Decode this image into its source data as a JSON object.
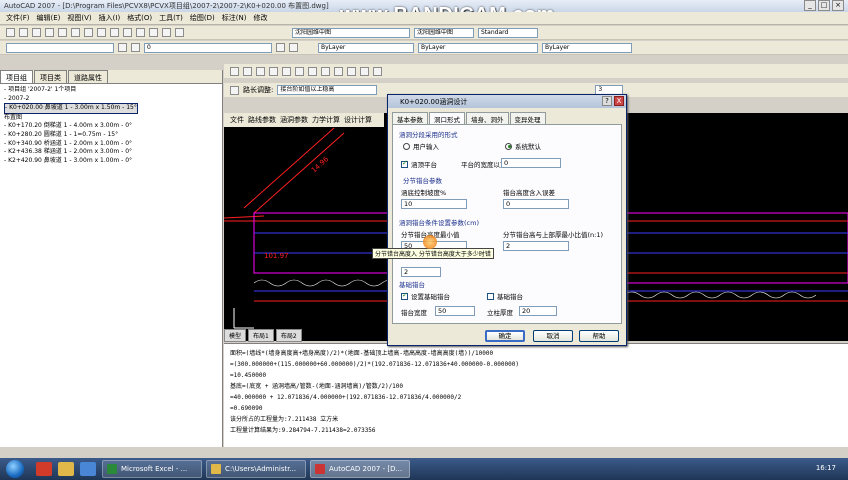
{
  "window": {
    "title": "AutoCAD 2007 - [D:\\Program Files\\PCVX8\\PCVX项目组\\2007-2\\2007-2\\K0+020.00 布置图.dwg]",
    "watermark": "www.BANDICAM.com"
  },
  "menu": [
    "文件(F)",
    "编辑(E)",
    "视图(V)",
    "插入(I)",
    "格式(O)",
    "工具(T)",
    "绘图(D)",
    "标注(N)",
    "修改"
  ],
  "toolbars": {
    "layer_combo": "0",
    "style_combo": "沈阳园维中图",
    "style2_combo": "沈阳园维中图",
    "standard_combo": "Standard",
    "color_combo": "ByLayer",
    "linetype_combo": "ByLayer",
    "lineweight_combo": "ByLayer",
    "road_label": "路长调整:",
    "road_combo": "接台阶如值以上稳高",
    "scale_value": "3"
  },
  "left_panel": {
    "tabs": [
      "项目组",
      "项目类",
      "道路属性"
    ],
    "tree": [
      "- 项目组 '2007-2' 1个项目",
      "  - 2007-2",
      "    - K0+020.00 鼻坡道 1 - 3.00m x 1.50m - 15°",
      "        布置图",
      "    - K0+170.20 倒梯道 1 - 4.00m x 3.00m - 0°",
      "    - K0+280.20 圆梯道 1 - 1=0.75m - 15°",
      "    - K0+340.90 桥涵道 1 - 2.00m x 1.00m - 0°",
      "    - K2+436.38 梯涵道 1 - 2.00m x 3.00m - 0°",
      "    - K2+420.90 鼻坡道 1 - 3.00m x 1.00m - 0°"
    ]
  },
  "right_toolbar": {
    "tabs": [
      "文件",
      "路线参数",
      "涵洞参数",
      "力学计算",
      "设计计算"
    ]
  },
  "cad_tabs": [
    "模型",
    "布局1",
    "布局2"
  ],
  "dialog": {
    "title": "K0+020.00涵洞设计",
    "help_btn": "?",
    "close_btn": "X",
    "tabs": [
      "基本参数",
      "洞口形式",
      "墙身、洞外",
      "变异处理"
    ],
    "opt_group": "涵洞分段采用的形式",
    "radio_user": "用户输入",
    "radio_system": "系统默认",
    "platform_check": "涵顶平台",
    "platform_label": "平台的宽度以顶",
    "platform_value": "0",
    "step_group": "分节错台参数",
    "step_width_label": "涵底控制坡度%",
    "step_width_value": "10",
    "step_height_label": "错台高度含入误差",
    "step_height_value": "0",
    "cond_group": "涵洞错台条件设置参数(cm)",
    "min_height_label": "分节错台高度最小值",
    "min_height_value": "50",
    "ratio_label": "分节错台高与上部厚最小比值(n:1)",
    "ratio_value": "2",
    "extra_value": "2",
    "base_group": "基础错台",
    "base_check": "设置基础错台",
    "base_step_check": "基础错台",
    "base_width_label": "错台宽度",
    "base_width_value": "50",
    "col_width_label": "立柱厚度",
    "col_width_value": "20",
    "ok": "确定",
    "cancel": "取消",
    "help": "帮助"
  },
  "tooltip": "分节错台高度入   分节错台高度大于多少时错",
  "command_lines": [
    "面积=(墙线*(墙身高度高+墙身高度)/2)*(地面-基础顶上墙高-墙高高度-墙高高度(墙))/10000",
    "=(300.000000+(115.000000+60.000000)/2)*(192.071836-12.071836+40.000000-0.000000)",
    "=10.450000",
    "基底=(底宽 + 涵洞墙高/管数-(地面-涵洞墙高)/管数/2)/100",
    "=40.000000 + 12.071836/4.000000+(192.071836-12.071836/4.000000/2",
    "=0.690090",
    "该分所占的工程量为:7.211438 立方米",
    "工程量计算结果为:9.284794-7.211438=2.073356"
  ],
  "taskbar": {
    "items": [
      "Microsoft Excel - ...",
      "C:\\Users\\Administr...",
      "AutoCAD 2007 - [D..."
    ],
    "clock": "16:17"
  },
  "colors": {
    "cad_bg": "#000000",
    "cad_red": "#ff2020",
    "cad_magenta": "#ff00ff",
    "cad_blue": "#3c3cff",
    "cad_white": "#ffffff"
  }
}
